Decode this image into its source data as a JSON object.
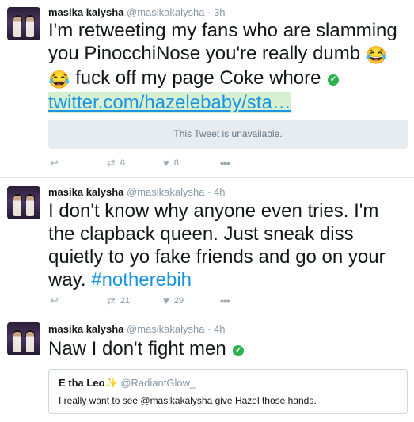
{
  "tweets": [
    {
      "name": "masika kalysha",
      "handle": "@masikakalysha",
      "dot": "·",
      "time": "3h",
      "text_parts": [
        "I'm retweeting my fans who are slamming you PinocchiNose you're really dumb ",
        " fuck off my page Coke whore "
      ],
      "emoji": "😂",
      "check": "✓",
      "link": "twitter.com/hazelebaby/sta…",
      "card_text": "This Tweet is unavailable.",
      "retweets": "6",
      "likes": "8"
    },
    {
      "name": "masika kalysha",
      "handle": "@masikakalysha",
      "dot": "·",
      "time": "4h",
      "text": "I don't know why anyone even tries. I'm the clapback queen. Just sneak diss quietly to yo fake friends and go on your way. ",
      "hashtag": "#notherebih",
      "retweets": "21",
      "likes": "29"
    },
    {
      "name": "masika kalysha",
      "handle": "@masikakalysha",
      "dot": "·",
      "time": "4h",
      "text": "Naw I don't fight men ",
      "check": "✓",
      "quote": {
        "name": "E tha Leo✨",
        "handle": "@RadiantGlow_",
        "text": "I really want to see @masikakalysha give Hazel those hands."
      }
    }
  ],
  "icons": {
    "reply": "reply-icon",
    "retweet": "retweet-icon",
    "like": "heart-icon",
    "more": "more-icon"
  },
  "colors": {
    "link": "#1b95e0",
    "verified": "#2bb24c",
    "muted": "#8899a6",
    "card_bg": "#e6ecf0"
  }
}
